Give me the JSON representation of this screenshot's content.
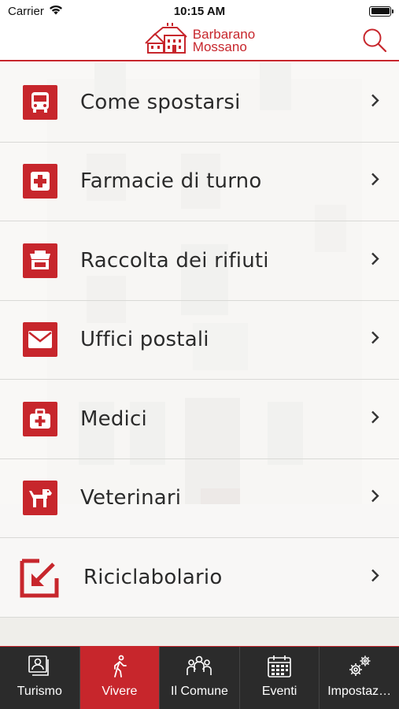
{
  "status_bar": {
    "carrier": "Carrier",
    "time": "10:15 AM"
  },
  "header": {
    "logo_line1": "Barbarano",
    "logo_line2": "Mossano",
    "accent_color": "#c7262c",
    "search_icon": "search-icon"
  },
  "menu": {
    "items": [
      {
        "label": "Come spostarsi",
        "icon": "bus-icon"
      },
      {
        "label": "Farmacie di turno",
        "icon": "pharmacy-cross-icon"
      },
      {
        "label": "Raccolta dei rifiuti",
        "icon": "waste-bin-icon"
      },
      {
        "label": "Uffici postali",
        "icon": "envelope-icon"
      },
      {
        "label": "Medici",
        "icon": "medical-kit-icon"
      },
      {
        "label": "Veterinari",
        "icon": "dog-icon"
      },
      {
        "label": "Riciclabolario",
        "icon": "recycle-arrow-icon"
      }
    ]
  },
  "tabbar": {
    "tabs": [
      {
        "label": "Turismo",
        "icon": "photo-album-icon",
        "active": false
      },
      {
        "label": "Vivere",
        "icon": "walking-person-icon",
        "active": true
      },
      {
        "label": "Il Comune",
        "icon": "people-group-icon",
        "active": false
      },
      {
        "label": "Eventi",
        "icon": "calendar-icon",
        "active": false
      },
      {
        "label": "Impostaz…",
        "icon": "gears-icon",
        "active": false
      }
    ]
  }
}
